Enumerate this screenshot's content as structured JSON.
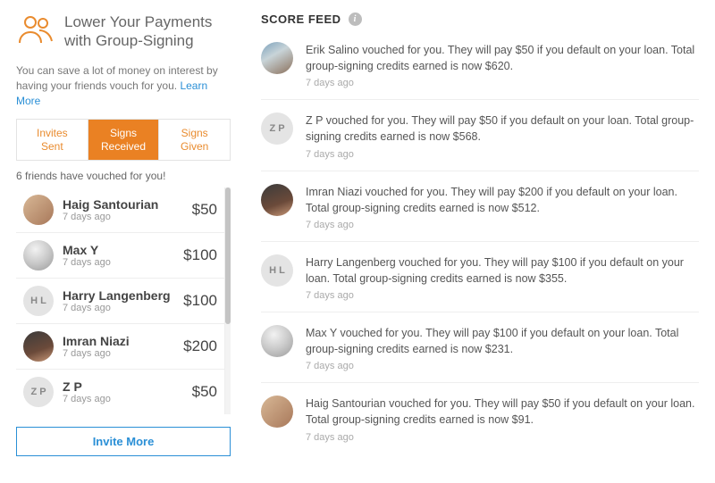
{
  "sidebar": {
    "title": "Lower Your Payments with Group-Signing",
    "intro_prefix": "You can save a lot of money on interest by having your friends vouch for you. ",
    "learn_more": "Learn More",
    "tabs": {
      "invites_sent_l1": "Invites",
      "invites_sent_l2": "Sent",
      "signs_received_l1": "Signs",
      "signs_received_l2": "Received",
      "signs_given_l1": "Signs",
      "signs_given_l2": "Given"
    },
    "vouched_count": "6 friends have vouched for you!",
    "friends": [
      {
        "name": "Haig Santourian",
        "time": "7 days ago",
        "amount": "$50",
        "avatar": "photo"
      },
      {
        "name": "Max Y",
        "time": "7 days ago",
        "amount": "$100",
        "avatar": "photo2"
      },
      {
        "name": "Harry Langenberg",
        "time": "7 days ago",
        "amount": "$100",
        "avatar": "initials",
        "initials": "H L"
      },
      {
        "name": "Imran Niazi",
        "time": "7 days ago",
        "amount": "$200",
        "avatar": "photo3"
      },
      {
        "name": "Z P",
        "time": "7 days ago",
        "amount": "$50",
        "avatar": "initials",
        "initials": "Z P"
      }
    ],
    "invite_more": "Invite More"
  },
  "feed": {
    "title": "SCORE FEED",
    "items": [
      {
        "text": "Erik Salino vouched for you. They will pay $50 if you default on your loan. Total group-signing credits earned is now $620.",
        "time": "7 days ago",
        "avatar": "photo4"
      },
      {
        "text": "Z P vouched for you. They will pay $50 if you default on your loan. Total group-signing credits earned is now $568.",
        "time": "7 days ago",
        "avatar": "initials",
        "initials": "Z P"
      },
      {
        "text": "Imran Niazi vouched for you. They will pay $200 if you default on your loan. Total group-signing credits earned is now $512.",
        "time": "7 days ago",
        "avatar": "photo3"
      },
      {
        "text": "Harry Langenberg vouched for you. They will pay $100 if you default on your loan. Total group-signing credits earned is now $355.",
        "time": "7 days ago",
        "avatar": "initials",
        "initials": "H L"
      },
      {
        "text": "Max Y vouched for you. They will pay $100 if you default on your loan. Total group-signing credits earned is now $231.",
        "time": "7 days ago",
        "avatar": "photo2"
      },
      {
        "text": "Haig Santourian vouched for you. They will pay $50 if you default on your loan. Total group-signing credits earned is now $91.",
        "time": "7 days ago",
        "avatar": "photo"
      }
    ]
  }
}
